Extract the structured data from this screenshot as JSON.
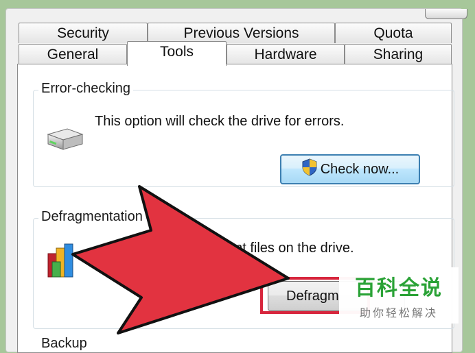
{
  "tabs_row1": [
    "Security",
    "Previous Versions",
    "Quota"
  ],
  "tabs_row2": [
    "General",
    "Tools",
    "Hardware",
    "Sharing"
  ],
  "active_tab": "Tools",
  "error_checking": {
    "legend": "Error-checking",
    "description": "This option will check the drive for errors.",
    "button": "Check now..."
  },
  "defragmentation": {
    "legend": "Defragmentation",
    "description": "ent files on the drive.",
    "button": "Defragm"
  },
  "backup": {
    "legend": "Backup"
  },
  "watermark": {
    "title": "百科全说",
    "subtitle": "助你轻松解决"
  },
  "colors": {
    "arrow": "#e23340",
    "highlight": "#d7263d",
    "watermark_green": "#2aa236"
  }
}
